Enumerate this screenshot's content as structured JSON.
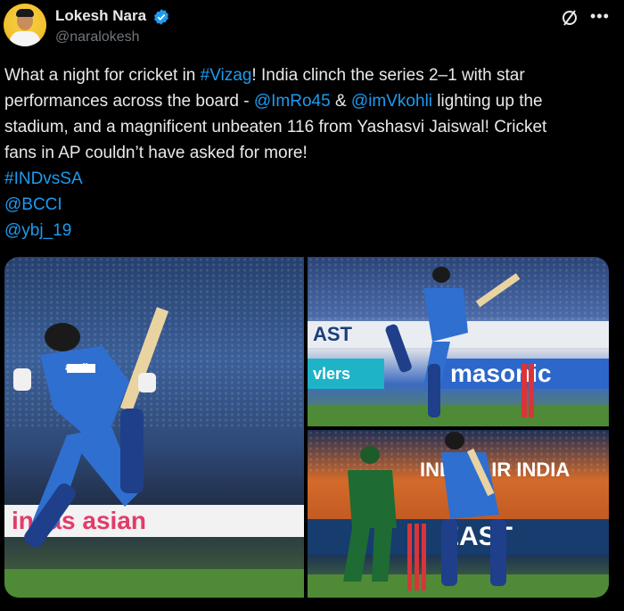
{
  "author": {
    "name": "Lokesh Nara",
    "handle": "@naralokesh",
    "verified": true
  },
  "post": {
    "segments_line1": [
      {
        "text": "What a night for cricket in ",
        "link": false
      },
      {
        "text": "#Vizag",
        "link": true
      },
      {
        "text": "! India clinch the series 2–1 with star",
        "link": false
      }
    ],
    "segments_line2": [
      {
        "text": "performances across the board - ",
        "link": false
      },
      {
        "text": "@ImRo45",
        "link": true
      },
      {
        "text": " & ",
        "link": false
      },
      {
        "text": "@imVkohli",
        "link": true
      },
      {
        "text": " lighting up the",
        "link": false
      }
    ],
    "line3": "stadium, and a magnificent unbeaten 116 from Yashasvi Jaiswal! Cricket",
    "line4": "fans in AP couldn’t have asked for more!",
    "hashtag": "#INDvsSA",
    "mention1": "@BCCI",
    "mention2": "@ybj_19"
  },
  "media": {
    "photo1_board": "insas  asian",
    "photo2_board_left": "AST",
    "photo2_board_right": "masonic",
    "photo2_board_small": "vlers",
    "photo3_board_top": "INDIA  AIR INDIA",
    "photo3_board_bottom": "EAST",
    "jersey_text": "apollo"
  },
  "colors": {
    "link": "#1d9bf0",
    "muted": "#71767b",
    "verified": "#1d9bf0",
    "jersey": "#2f6fd0"
  },
  "icons": {
    "verified": "verified-badge-icon",
    "grok": "grok-icon",
    "more": "more-options-icon"
  }
}
